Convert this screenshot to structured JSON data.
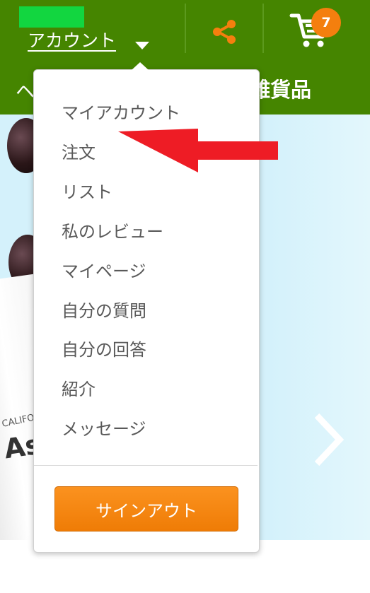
{
  "header": {
    "account_label": "アカウント",
    "cart_count": "7",
    "nav_left_partial": "ヘ",
    "nav_right_partial": "雑貨品"
  },
  "icons": {
    "caret": "caret-down-icon",
    "share": "share-icon",
    "cart": "cart-icon",
    "next": "chevron-right-icon"
  },
  "colors": {
    "header_bg": "#458500",
    "accent_orange": "#f47f0e",
    "hero_bg": "#d4f1fb",
    "arrow_red": "#ee1c25"
  },
  "hero": {
    "bottle_brand": "CALIFORNIA",
    "bottle_name": "As"
  },
  "account_menu": {
    "items": [
      "マイアカウント",
      "注文",
      "リスト",
      "私のレビュー",
      "マイページ",
      "自分の質問",
      "自分の回答",
      "紹介",
      "メッセージ"
    ],
    "signout_label": "サインアウト"
  }
}
